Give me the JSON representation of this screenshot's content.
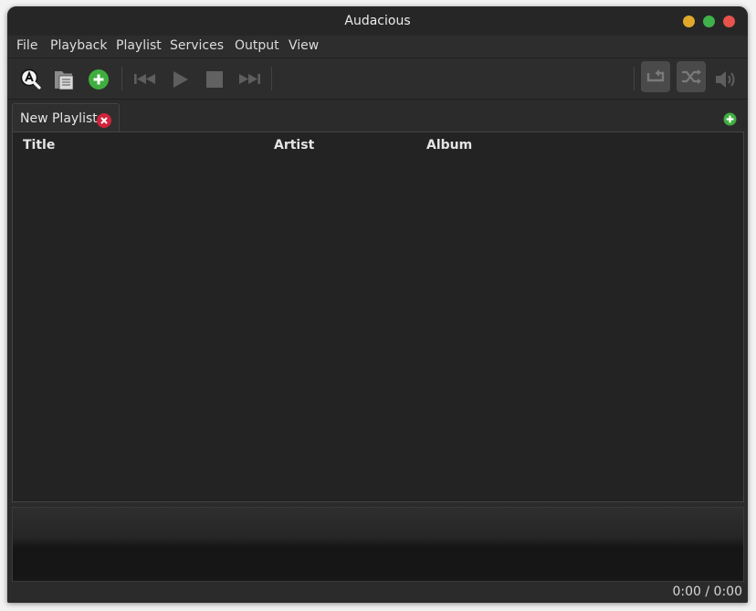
{
  "window": {
    "title": "Audacious"
  },
  "menu": {
    "file": "File",
    "playback": "Playback",
    "playlist": "Playlist",
    "services": "Services",
    "output": "Output",
    "view": "View"
  },
  "toolbar": {
    "icons": [
      "search-library-icon",
      "open-files-icon",
      "add-files-icon",
      "previous-icon",
      "play-icon",
      "stop-icon",
      "next-icon",
      "repeat-icon",
      "shuffle-icon",
      "volume-icon"
    ]
  },
  "playlist_tabs": [
    {
      "label": "New Playlist",
      "active": true
    }
  ],
  "columns": {
    "title": "Title",
    "artist": "Artist",
    "album": "Album"
  },
  "status": {
    "time": "0:00 / 0:00"
  },
  "colors": {
    "minimize": "#e0a92b",
    "maximize": "#3fb24b",
    "close": "#e5534b",
    "add_green": "#3fae3f",
    "tab_close": "#d2233c"
  }
}
